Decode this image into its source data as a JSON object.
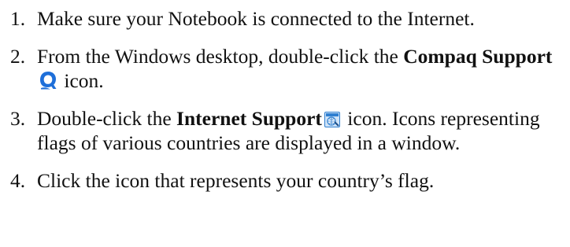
{
  "steps": [
    {
      "number": "1.",
      "text": "Make sure your Notebook is connected to the Internet."
    },
    {
      "number": "2.",
      "before": "From the Windows desktop, double-click the ",
      "bold": "Compaq Support",
      "after": " icon.",
      "icon": "compaq-q-icon"
    },
    {
      "number": "3.",
      "before": "Double-click the ",
      "bold": "Internet Support",
      "after": " icon. Icons representing flags of various countries are displayed in a window.",
      "icon": "internet-support-icon"
    },
    {
      "number": "4.",
      "text": "Click the icon that represents your country’s flag."
    }
  ],
  "colors": {
    "text": "#111111",
    "compaq_icon": "#1e6fd9",
    "internet_icon": "#2f7fd0"
  }
}
